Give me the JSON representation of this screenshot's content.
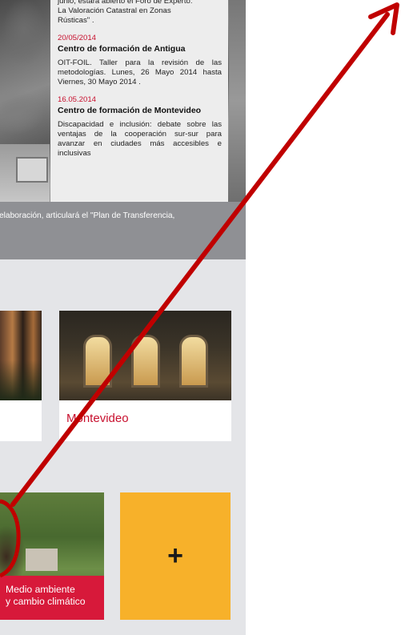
{
  "news": {
    "top_text": [
      "junio, estará abierto el Foro de Experto:",
      "La Valoración Catastral en Zonas",
      "Rústicas\" ."
    ],
    "items": [
      {
        "date": "20/05/2014",
        "title": "Centro de formación de Antigua",
        "desc": "OIT-FOIL. Taller para la revisión de las metodologías. Lunes, 26 Mayo 2014 hasta Viernes, 30 Mayo 2014 ."
      },
      {
        "date": "16.05.2014",
        "title": "Centro de formación de Montevideo",
        "desc": "Discapacidad e inclusión: debate sobre las ventajas de la cooperación sur-sur para avanzar en ciudades más accesibles e inclusivas"
      }
    ]
  },
  "band_text": "elaboración, articulará el \"Plan de Transferencia,",
  "cards": {
    "montevideo_label": "Montevideo"
  },
  "tiles": {
    "environment_line1": "Medio ambiente",
    "environment_line2": "y cambio climático",
    "plus_label": "+"
  },
  "colors": {
    "accent_red": "#c8102e",
    "tile_red": "#d7193a",
    "tile_yellow": "#f7b12a",
    "band_grey": "#8f9094",
    "annotation_red": "#c00000"
  },
  "icons": {
    "annotation": "arrow-icon"
  }
}
